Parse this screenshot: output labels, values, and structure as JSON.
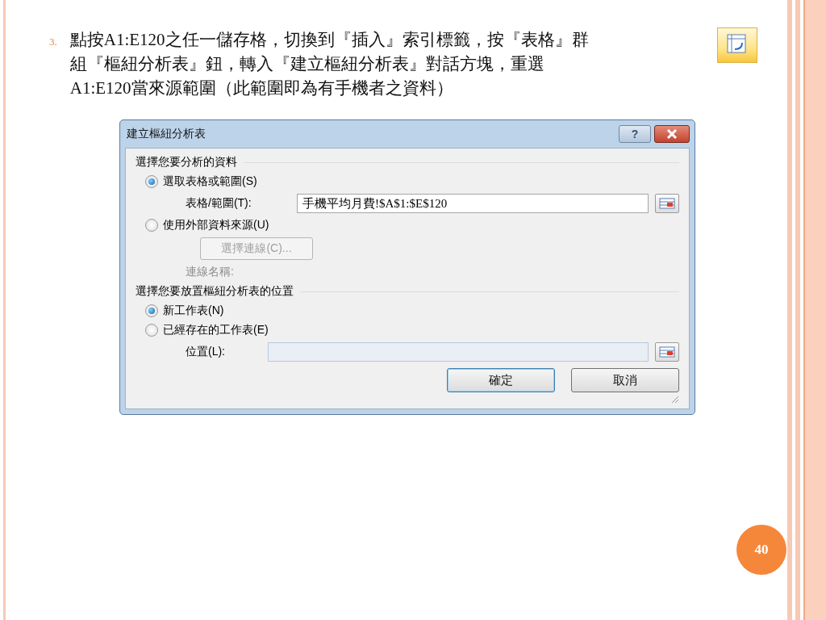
{
  "slide": {
    "bullet": "3.",
    "lines": [
      "點按A1:E120之任一儲存格，切換到『插入』索引標籤，按『表格』群",
      "組『樞紐分析表』鈕，轉入『建立樞紐分析表』對話方塊，重選",
      "A1:E120當來源範圍（此範圍即為有手機者之資料）"
    ],
    "page_number": "40"
  },
  "dialog": {
    "title": "建立樞紐分析表",
    "help_button": "?",
    "section_1": {
      "heading": "選擇您要分析的資料",
      "options": [
        {
          "label": "選取表格或範圍(S)",
          "selected": true
        },
        {
          "label": "使用外部資料來源(U)",
          "selected": false
        }
      ],
      "range_label": "表格/範圍(T):",
      "range_value": "手機平均月費!$A$1:$E$120",
      "connection_button": {
        "label": "選擇連線(C)...",
        "disabled": true
      },
      "connection_name_label": "連線名稱:"
    },
    "section_2": {
      "heading": "選擇您要放置樞紐分析表的位置",
      "options": [
        {
          "label": "新工作表(N)",
          "selected": true
        },
        {
          "label": "已經存在的工作表(E)",
          "selected": false
        }
      ],
      "location_label": "位置(L):",
      "location_disabled": true
    },
    "buttons": [
      {
        "label": "確定",
        "default": true
      },
      {
        "label": "取消",
        "default": false
      }
    ]
  }
}
